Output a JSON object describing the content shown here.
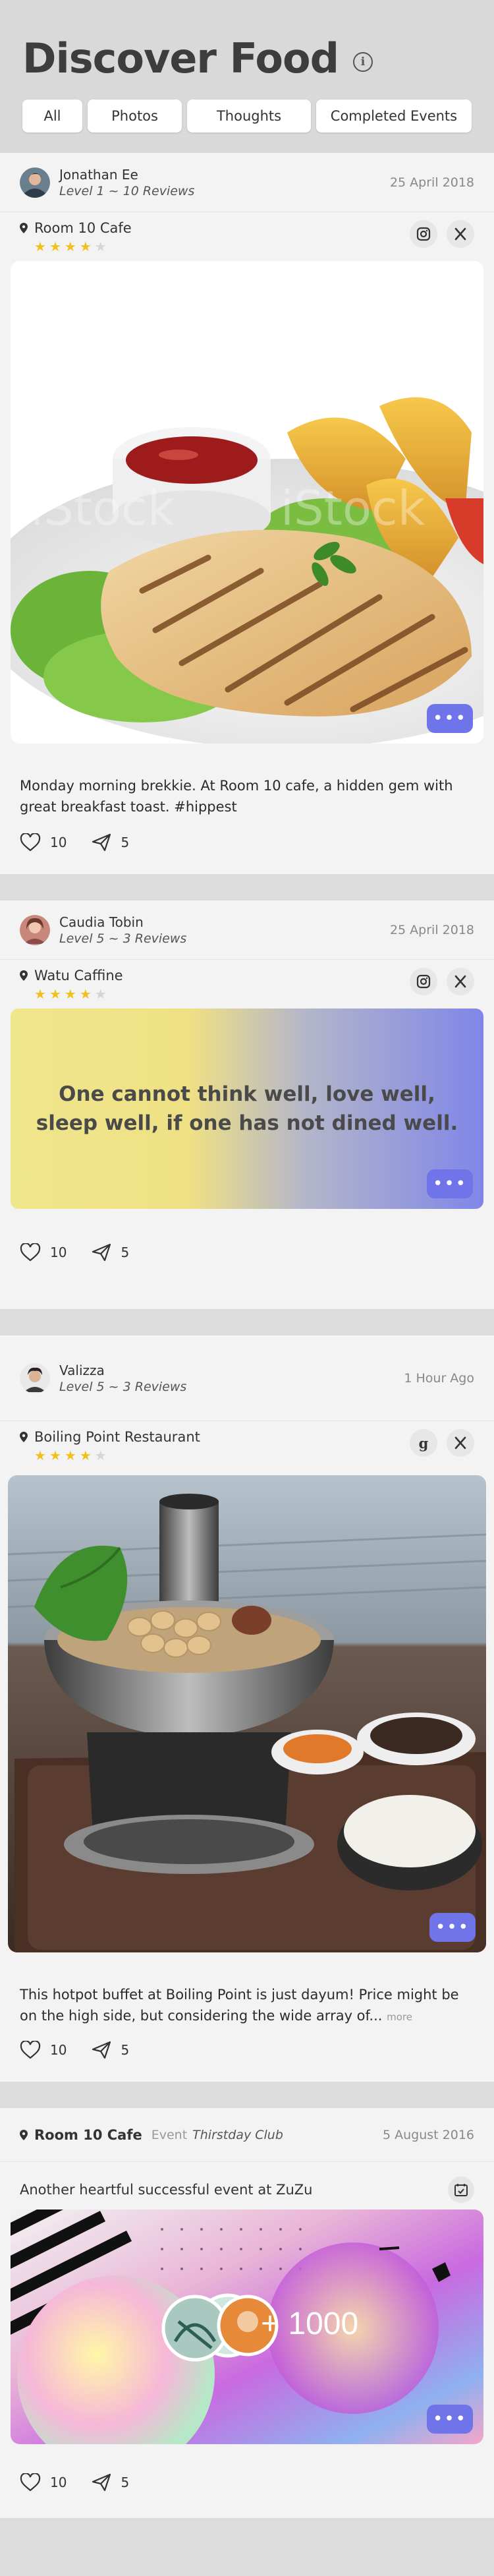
{
  "header": {
    "title": "Discover Food",
    "tabs": [
      {
        "label": "All"
      },
      {
        "label": "Photos"
      },
      {
        "label": "Thoughts"
      },
      {
        "label": "Completed Events"
      }
    ]
  },
  "posts": [
    {
      "user": "Jonathan Ee",
      "level": "Level 1 ~ 10 Reviews",
      "date": "25 April 2018",
      "place": "Room 10 Cafe",
      "rating": 4,
      "caption": "Monday morning brekkie. At Room 10 cafe, a hidden gem with great breakfast toast. #hippest",
      "likes": "10",
      "shares": "5",
      "watermark": "iStock"
    },
    {
      "user": "Caudia Tobin",
      "level": "Level 5 ~ 3 Reviews",
      "date": "25 April 2018",
      "place": "Watu Caffine",
      "rating": 4,
      "quote": "One cannot think well, love well, sleep well, if one has not dined well.",
      "likes": "10",
      "shares": "5"
    },
    {
      "user": "Valizza",
      "level": "Level 5 ~ 3 Reviews",
      "date": "1 Hour Ago",
      "place": "Boiling Point Restaurant",
      "rating": 4,
      "caption": "This hotpot buffet at Boiling Point is just dayum! Price might be on the high side, but considering the wide array of...",
      "caption_more": "more",
      "likes": "10",
      "shares": "5"
    }
  ],
  "event": {
    "place": "Room 10 Cafe",
    "label": "Event",
    "name": "Thirstday Club",
    "date": "5 August 2016",
    "title": "Another heartful successful event at ZuZu",
    "attendees": "+ 1000",
    "likes": "10",
    "shares": "5"
  },
  "icons": {
    "info": "info-circle-icon",
    "pin": "location-pin-icon",
    "instagram": "instagram-icon",
    "utensils": "fork-knife-icon",
    "google": "google-icon",
    "heart": "heart-icon",
    "share": "send-icon",
    "calendar": "calendar-check-icon",
    "more": "more-dots-icon"
  },
  "colors": {
    "accent": "#6f75e8",
    "star": "#f2c01c",
    "background": "#dcdcdc"
  }
}
